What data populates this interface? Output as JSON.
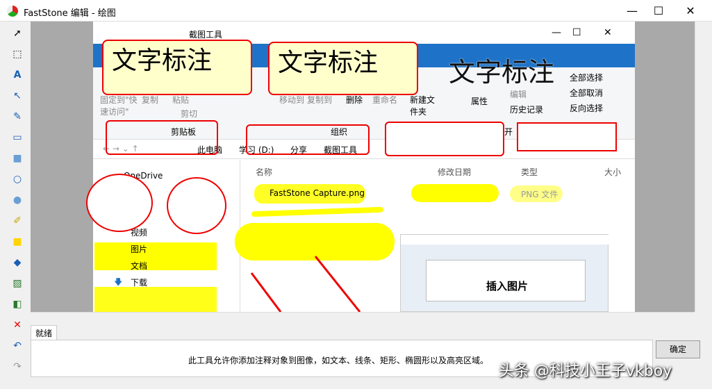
{
  "window": {
    "title": "FastStone 编辑 - 绘图",
    "minimize": "—",
    "maximize": "☐",
    "close": "✕"
  },
  "toolbar": {
    "tools": [
      "select-arrow-icon",
      "rect-select-icon",
      "text-icon",
      "arrow-icon",
      "pen-icon",
      "rectangle-icon",
      "filled-rectangle-icon",
      "ellipse-icon",
      "filled-ellipse-icon",
      "highlighter-icon",
      "highlight-rect-icon",
      "fill-icon",
      "insert-image-icon",
      "layer-icon",
      "delete-icon",
      "undo-icon",
      "redo-icon"
    ]
  },
  "explorer": {
    "title": "截图工具",
    "ribbon": {
      "clipboard_label": "剪贴板",
      "organize_label": "组织",
      "pin_label": "固定到\"快速访问\"",
      "copy": "复制",
      "paste": "粘贴",
      "cut": "剪切",
      "moveto": "移动到",
      "copyto": "复制到",
      "delete": "删除",
      "rename": "重命名",
      "newfolder": "新建文件夹",
      "properties": "属性",
      "edit": "编辑",
      "history": "历史记录",
      "select_all": "全部选择",
      "select_none": "全部取消",
      "invert": "反向选择",
      "open_group": "开"
    },
    "breadcrumb": [
      "此电脑",
      "学习 (D:)",
      "分享",
      "截图工具"
    ],
    "columns": {
      "name": "名称",
      "date": "修改日期",
      "type": "类型",
      "size": "大小"
    },
    "file": {
      "name": "FastStone Capture.png",
      "type": "PNG 文件"
    },
    "nav": {
      "onedrive": "OneDrive",
      "video": "视频",
      "pictures": "图片",
      "docs": "文档",
      "download": "下载"
    }
  },
  "annotations": {
    "callout1": "文字标注",
    "callout2": "文字标注",
    "callout3": "文字标注",
    "insert": "插入图片"
  },
  "status": {
    "tab": "就绪",
    "hint": "此工具允许你添加注释对象到图像，如文本、线条、矩形、椭圆形以及高亮区域。"
  },
  "buttons": {
    "confirm": "确定"
  },
  "watermark": "头条 @科技小王子vkboy"
}
